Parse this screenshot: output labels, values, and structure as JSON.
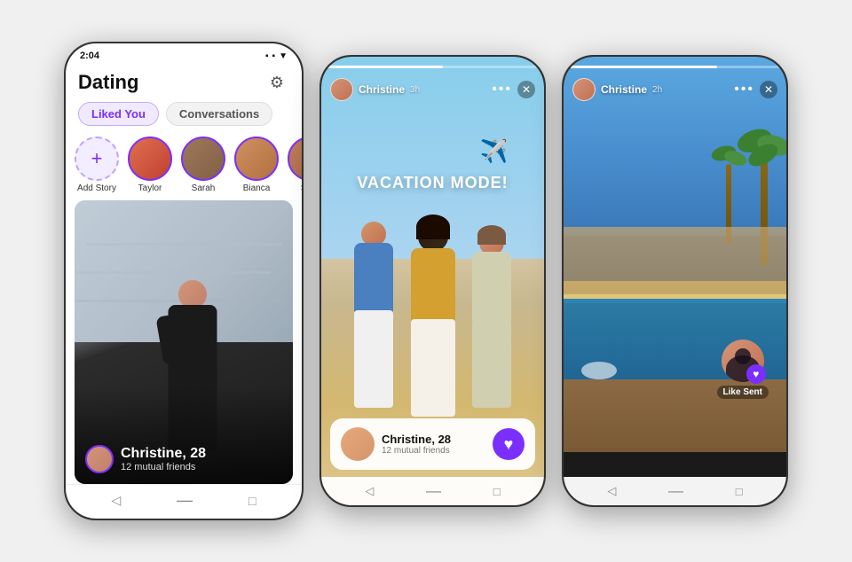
{
  "page": {
    "bg_color": "#e8e8e8"
  },
  "phone_left": {
    "status_time": "2:04",
    "status_icons": "▪ ▪ ▼",
    "title": "Dating",
    "tab_liked": "Liked You",
    "tab_conversations": "Conversations",
    "stories": [
      {
        "label": "Add Story",
        "type": "add"
      },
      {
        "label": "Taylor",
        "type": "story"
      },
      {
        "label": "Sarah",
        "type": "story"
      },
      {
        "label": "Bianca",
        "type": "story"
      },
      {
        "label": "Sp...",
        "type": "story"
      }
    ],
    "card_name": "Christine, 28",
    "card_sub": "12 mutual friends",
    "nav_items": [
      "◁",
      "—",
      "□"
    ]
  },
  "phone_middle": {
    "story_user": "Christine",
    "story_time": "3h",
    "vacation_text": "VACATION MODE!",
    "plane_emoji": "✈️",
    "card_name": "Christine, 28",
    "card_sub": "12 mutual friends",
    "like_icon": "♥",
    "nav_items": [
      "◁",
      "—",
      "□"
    ]
  },
  "phone_right": {
    "story_user": "Christine",
    "story_time": "2h",
    "like_sent_label": "Like Sent",
    "nav_items": [
      "◁",
      "—",
      "□"
    ]
  }
}
